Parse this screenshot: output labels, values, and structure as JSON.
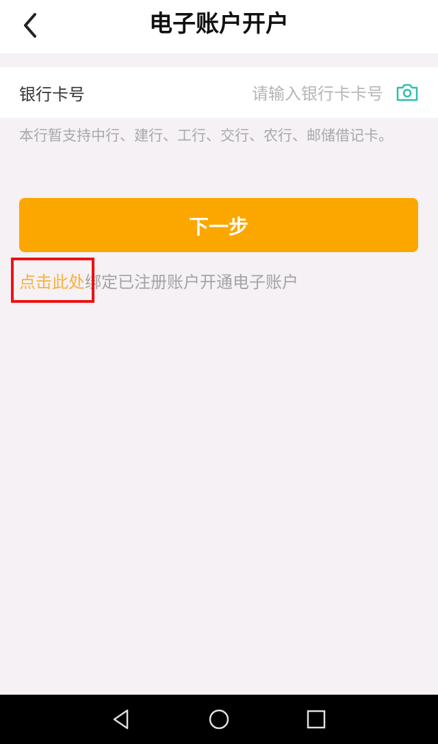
{
  "header": {
    "title": "电子账户开户",
    "back_icon": "chevron-left-icon"
  },
  "card_field": {
    "label": "银行卡号",
    "placeholder": "请输入银行卡卡号",
    "value": "",
    "camera_icon": "camera-icon",
    "camera_color": "#2bbfa6"
  },
  "hint": "本行暂支持中行、建行、工行、交行、农行、邮储借记卡。",
  "next_button": {
    "label": "下一步",
    "color": "#fca700"
  },
  "bind": {
    "link_text": "点击此处",
    "rest_text": "绑定已注册账户开通电子账户",
    "link_color": "#f6b23a"
  },
  "nav_bar": {
    "back_icon": "triangle-back-icon",
    "home_icon": "circle-home-icon",
    "recent_icon": "square-recents-icon"
  }
}
